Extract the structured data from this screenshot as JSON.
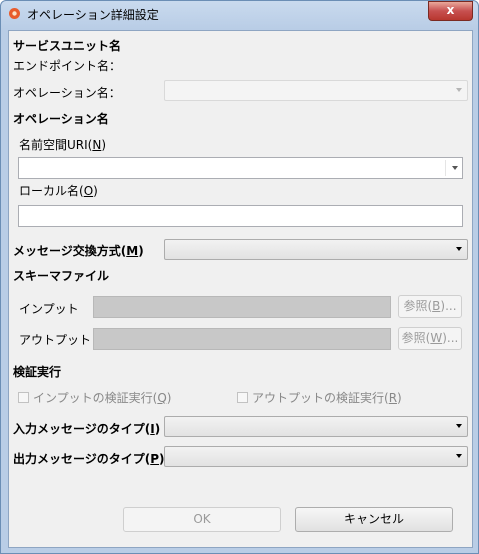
{
  "window": {
    "title": "オペレーション詳細設定",
    "close_glyph": "x"
  },
  "service_unit": {
    "heading": "サービスユニット名",
    "endpoint_label": "エンドポイント名：",
    "operation_label": "オペレーション名：",
    "operation_value": ""
  },
  "operation": {
    "heading": "オペレーション名",
    "namespace_label": "名前空間URI(",
    "namespace_mnemonic": "N",
    "namespace_value": "",
    "local_label": "ローカル名(",
    "local_mnemonic": "O",
    "local_value": ""
  },
  "message_exchange": {
    "label": "メッセージ交換方式(",
    "mnemonic": "M",
    "value": ""
  },
  "schema": {
    "heading": "スキーマファイル",
    "input_label": "インプット",
    "input_value": "",
    "input_browse_label": "参照(",
    "input_browse_mnemonic": "B",
    "output_label": "アウトプット",
    "output_value": "",
    "output_browse_label": "参照(",
    "output_browse_mnemonic": "W"
  },
  "validation": {
    "heading": "検証実行",
    "input_check_label": "インプットの検証実行(",
    "input_check_mnemonic": "Q",
    "output_check_label": "アウトプットの検証実行(",
    "output_check_mnemonic": "R"
  },
  "input_message_type": {
    "label": "入力メッセージのタイプ(",
    "mnemonic": "I",
    "value": ""
  },
  "output_message_type": {
    "label": "出力メッセージのタイプ(",
    "mnemonic": "P",
    "value": ""
  },
  "buttons": {
    "ok": "OK",
    "cancel": "キャンセル"
  },
  "common": {
    "close_paren": ")",
    "ellipsis": ")..."
  }
}
